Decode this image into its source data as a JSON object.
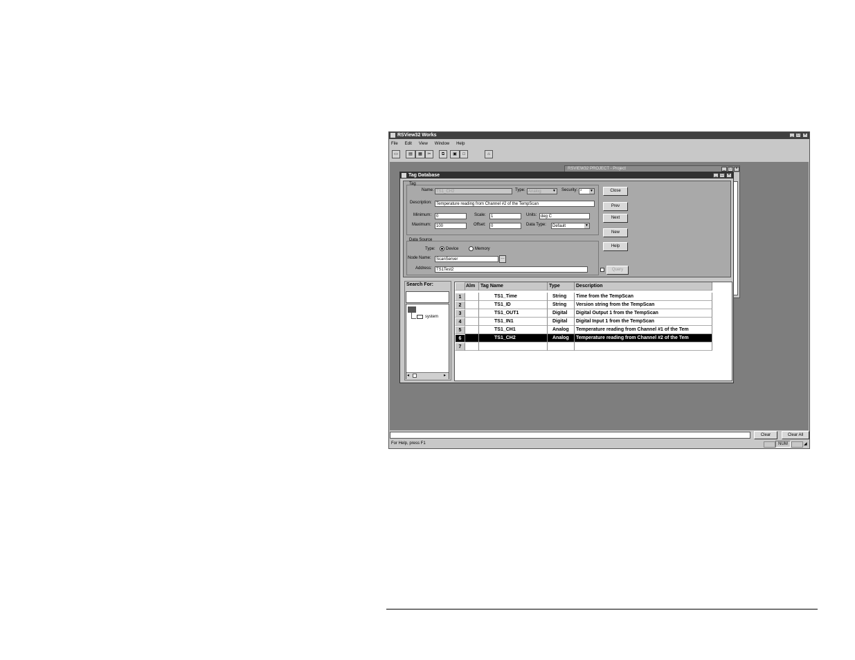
{
  "app": {
    "title": "RSView32 Works",
    "menu": [
      "File",
      "Edit",
      "View",
      "Window",
      "Help"
    ],
    "toolbar_icons": [
      "new-icon",
      "open-icon",
      "save-icon",
      "cut-icon",
      "copy-icon",
      "paste-icon",
      "print-icon"
    ],
    "back_window_title": "RSVIEW32 PROJECT - Project",
    "status_text": "For Help, press F1",
    "status_indicator": "NUM",
    "clear_label": "Clear",
    "clear_all_label": "Clear All"
  },
  "dialog": {
    "title": "Tag Database",
    "tag_group": "Tag",
    "name_label": "Name:",
    "name_value": "TS1_CH2",
    "type_label": "Type:",
    "type_value": "Analog",
    "security_label": "Security:",
    "security_value": "*",
    "description_label": "Description:",
    "description_value": "Temperature reading from Channel #2 of the TempScan",
    "minimum_label": "Minimum:",
    "minimum_value": "0",
    "scale_label": "Scale:",
    "scale_value": "1",
    "units_label": "Units:",
    "units_value": "deg C",
    "maximum_label": "Maximum:",
    "maximum_value": "100",
    "offset_label": "Offset:",
    "offset_value": "0",
    "datatype_label": "Data Type:",
    "datatype_value": "Default",
    "datasource_group": "Data Source",
    "ds_type_label": "Type:",
    "device_label": "Device",
    "memory_label": "Memory",
    "nodename_label": "Node Name:",
    "nodename_value": "ScanServer",
    "address_label": "Address:",
    "address_value": "TS1Test2",
    "buttons": {
      "close": "Close",
      "prev": "Prev",
      "next": "Next",
      "new": "New",
      "help": "Help",
      "query": "Query"
    },
    "search_label": "Search For:",
    "search_value": "",
    "tree_item": "system",
    "grid": {
      "headers": [
        "Alm",
        "Tag Name",
        "Type",
        "Description"
      ],
      "rows": [
        {
          "num": "1",
          "tag": "TS1_Time",
          "type": "String",
          "desc": "Time from the TempScan"
        },
        {
          "num": "2",
          "tag": "TS1_ID",
          "type": "String",
          "desc": "Version string from the TempScan"
        },
        {
          "num": "3",
          "tag": "TS1_OUT1",
          "type": "Digital",
          "desc": "Digital Output 1 from the TempScan"
        },
        {
          "num": "4",
          "tag": "TS1_IN1",
          "type": "Digital",
          "desc": "Digital Input 1 from the TempScan"
        },
        {
          "num": "5",
          "tag": "TS1_CH1",
          "type": "Analog",
          "desc": "Temperature reading from Channel #1 of the Tem"
        },
        {
          "num": "6",
          "tag": "TS1_CH2",
          "type": "Analog",
          "desc": "Temperature reading from Channel #2 of the Tem"
        },
        {
          "num": "7",
          "tag": "",
          "type": "",
          "desc": ""
        }
      ]
    }
  }
}
